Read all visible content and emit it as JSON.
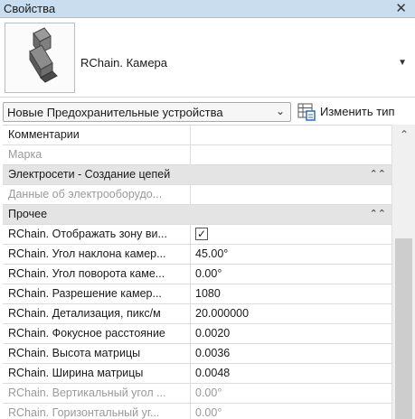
{
  "panel": {
    "title": "Свойства",
    "close_glyph": "✕"
  },
  "type_selector": {
    "type_name": "RChain. Камера",
    "dropdown_glyph": "▼"
  },
  "filter": {
    "selected": "Новые Предохранительные устройства",
    "chevron": "⌄",
    "edit_type_label": "Изменить тип"
  },
  "grid": {
    "rows": [
      {
        "name": "Комментарии",
        "value": ""
      },
      {
        "name": "Марка",
        "value": ""
      },
      {
        "group": "Электросети - Создание цепей"
      },
      {
        "name": "Данные об электрооборудо...",
        "value": ""
      },
      {
        "group": "Прочее"
      },
      {
        "name": "RChain. Отображать зону ви...",
        "value": "✓"
      },
      {
        "name": "RChain. Угол наклона камер...",
        "value": "45.00°"
      },
      {
        "name": "RChain. Угол поворота каме...",
        "value": "0.00°"
      },
      {
        "name": "RChain. Разрешение камер...",
        "value": "1080"
      },
      {
        "name": "RChain. Детализация, пикс/м",
        "value": "20.000000"
      },
      {
        "name": "RChain. Фокусное расстояние",
        "value": "0.0020"
      },
      {
        "name": "RChain. Высота матрицы",
        "value": "0.0036"
      },
      {
        "name": "RChain. Ширина матрицы",
        "value": "0.0048"
      },
      {
        "name": "RChain. Вертикальный угол ...",
        "value": "0.00°"
      },
      {
        "name": "RChain. Горизонтальный уг...",
        "value": "0.00°"
      }
    ],
    "collapse_glyph": "⌃⌃"
  },
  "scrollbar": {
    "up_glyph": "⌃"
  }
}
